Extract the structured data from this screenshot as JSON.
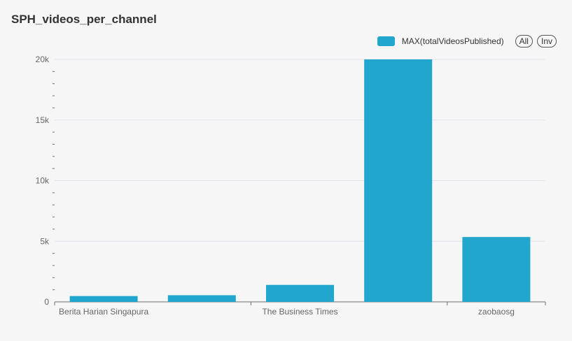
{
  "title": "SPH_videos_per_channel",
  "legend": {
    "series_label": "MAX(totalVideosPublished)",
    "all_button": "All",
    "inv_button": "Inv"
  },
  "colors": {
    "bar": "#21a7cd",
    "grid": "#e0e3ec",
    "axis": "#6e6e6e"
  },
  "chart_data": {
    "type": "bar",
    "title": "SPH_videos_per_channel",
    "categories": [
      "Berita Harian Singapura",
      "",
      "The Business Times",
      "",
      "zaobaosg"
    ],
    "series": [
      {
        "name": "MAX(totalVideosPublished)",
        "values": [
          480,
          550,
          1400,
          20000,
          5350
        ]
      }
    ],
    "ylim": [
      0,
      20000
    ],
    "yticks": [
      0,
      5000,
      10000,
      15000,
      20000
    ],
    "ytick_labels": [
      "0",
      "5k",
      "10k",
      "15k",
      "20k"
    ],
    "grid": true,
    "legend_position": "top-right"
  }
}
